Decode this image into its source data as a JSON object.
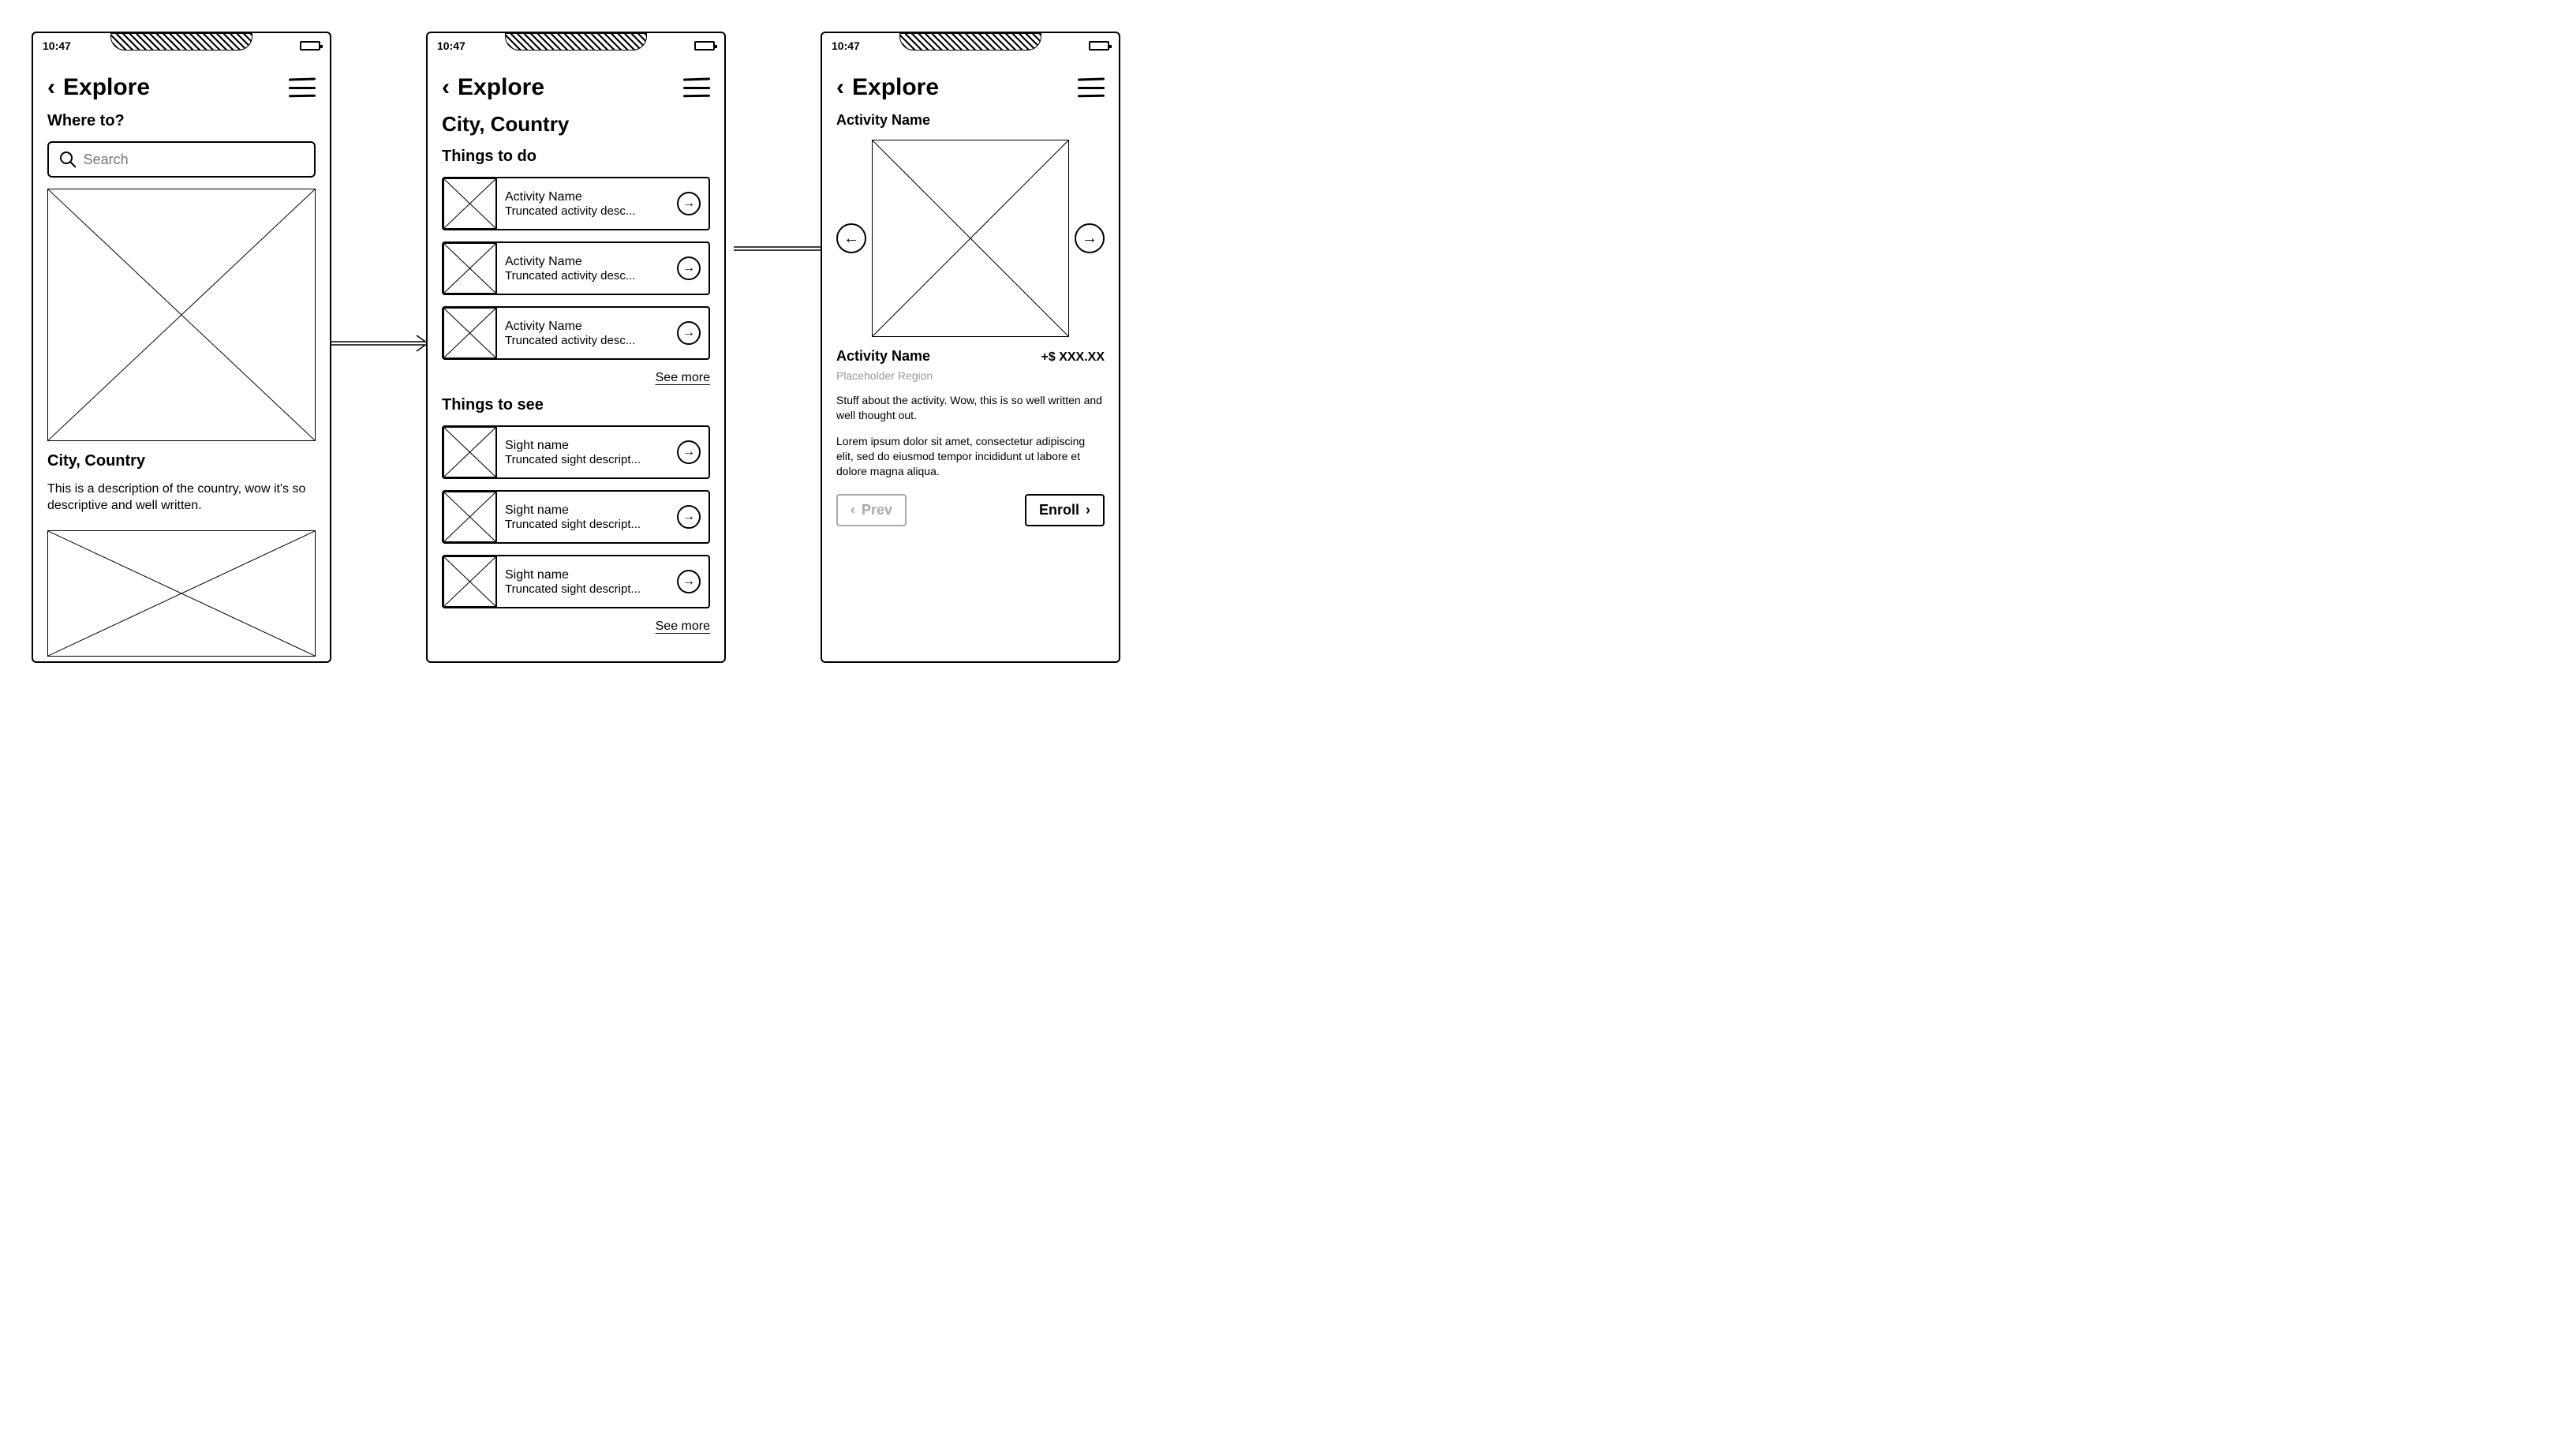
{
  "status": {
    "time": "10:47"
  },
  "screen1": {
    "title": "Explore",
    "where_label": "Where to?",
    "search_placeholder": "Search",
    "city_title": "City, Country",
    "city_desc": "This is a description of the country, wow it's so descriptive and well written."
  },
  "screen2": {
    "title": "Explore",
    "city_title": "City, Country",
    "things_to_do_label": "Things to do",
    "things_to_see_label": "Things to see",
    "see_more": "See more",
    "activities": [
      {
        "name": "Activity Name",
        "desc": "Truncated activity desc..."
      },
      {
        "name": "Activity Name",
        "desc": "Truncated activity desc..."
      },
      {
        "name": "Activity Name",
        "desc": "Truncated activity desc..."
      }
    ],
    "sights": [
      {
        "name": "Sight name",
        "desc": "Truncated sight descript..."
      },
      {
        "name": "Sight name",
        "desc": "Truncated sight descript..."
      },
      {
        "name": "Sight name",
        "desc": "Truncated sight descript..."
      }
    ]
  },
  "screen3": {
    "title": "Explore",
    "activity_label": "Activity Name",
    "activity_name": "Activity Name",
    "price": "+$ XXX.XX",
    "region": "Placeholder Region",
    "para1": "Stuff about the activity. Wow, this is so well written and well thought out.",
    "para2": "Lorem ipsum dolor sit amet, consectetur adipiscing elit, sed do eiusmod tempor incididunt ut labore et dolore magna aliqua.",
    "prev_label": "Prev",
    "enroll_label": "Enroll"
  }
}
